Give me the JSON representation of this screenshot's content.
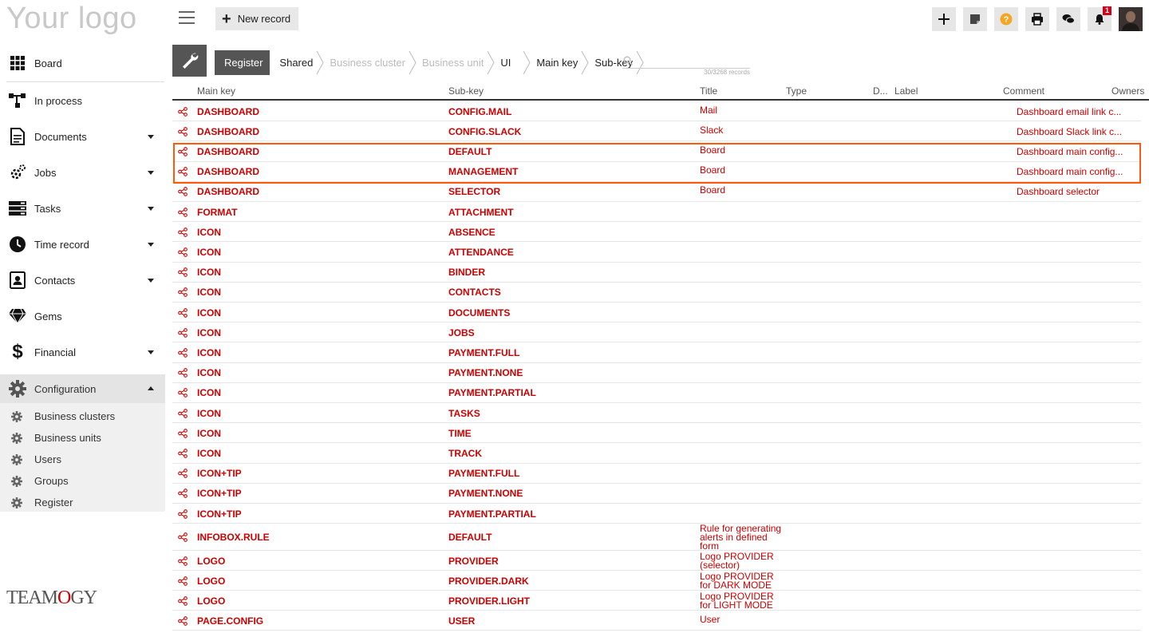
{
  "header": {
    "logo": "Your logo",
    "new_record": "New record",
    "notification_count": "1"
  },
  "sidebar": {
    "items": [
      {
        "label": "Board",
        "icon": "grid-icon"
      },
      {
        "label": "In process",
        "icon": "flow-icon"
      },
      {
        "label": "Documents",
        "icon": "document-icon"
      },
      {
        "label": "Jobs",
        "icon": "jobs-icon"
      },
      {
        "label": "Tasks",
        "icon": "tasks-icon"
      },
      {
        "label": "Time record",
        "icon": "clock-icon"
      },
      {
        "label": "Contacts",
        "icon": "contacts-icon"
      },
      {
        "label": "Gems",
        "icon": "diamond-icon"
      },
      {
        "label": "Financial",
        "icon": "dollar-icon"
      },
      {
        "label": "Configuration",
        "icon": "gear-icon"
      }
    ],
    "sub_items": [
      "Business clusters",
      "Business units",
      "Users",
      "Groups",
      "Register"
    ],
    "footer_logo": "TEAMOGY"
  },
  "breadcrumb": [
    "Register",
    "Shared",
    "Business cluster",
    "Business unit",
    "UI",
    "Main key",
    "Sub-key"
  ],
  "search": {
    "placeholder": "",
    "count": "30/3268 records"
  },
  "columns": [
    "Main key",
    "Sub-key",
    "Title",
    "Type",
    "D...",
    "Label",
    "Comment",
    "Owners"
  ],
  "rows": [
    {
      "key": "DASHBOARD",
      "sub": "CONFIG.MAIL",
      "title": "Mail",
      "comment": "Dashboard email link c..."
    },
    {
      "key": "DASHBOARD",
      "sub": "CONFIG.SLACK",
      "title": "Slack",
      "comment": "Dashboard Slack link c..."
    },
    {
      "key": "DASHBOARD",
      "sub": "DEFAULT",
      "title": "Board",
      "comment": "Dashboard main config..."
    },
    {
      "key": "DASHBOARD",
      "sub": "MANAGEMENT",
      "title": "Board",
      "comment": "Dashboard main config..."
    },
    {
      "key": "DASHBOARD",
      "sub": "SELECTOR",
      "title": "Board",
      "comment": "Dashboard selector"
    },
    {
      "key": "FORMAT",
      "sub": "ATTACHMENT",
      "title": "",
      "comment": ""
    },
    {
      "key": "ICON",
      "sub": "ABSENCE",
      "title": "",
      "comment": ""
    },
    {
      "key": "ICON",
      "sub": "ATTENDANCE",
      "title": "",
      "comment": ""
    },
    {
      "key": "ICON",
      "sub": "BINDER",
      "title": "",
      "comment": ""
    },
    {
      "key": "ICON",
      "sub": "CONTACTS",
      "title": "",
      "comment": ""
    },
    {
      "key": "ICON",
      "sub": "DOCUMENTS",
      "title": "",
      "comment": ""
    },
    {
      "key": "ICON",
      "sub": "JOBS",
      "title": "",
      "comment": ""
    },
    {
      "key": "ICON",
      "sub": "PAYMENT.FULL",
      "title": "",
      "comment": ""
    },
    {
      "key": "ICON",
      "sub": "PAYMENT.NONE",
      "title": "",
      "comment": ""
    },
    {
      "key": "ICON",
      "sub": "PAYMENT.PARTIAL",
      "title": "",
      "comment": ""
    },
    {
      "key": "ICON",
      "sub": "TASKS",
      "title": "",
      "comment": ""
    },
    {
      "key": "ICON",
      "sub": "TIME",
      "title": "",
      "comment": ""
    },
    {
      "key": "ICON",
      "sub": "TRACK",
      "title": "",
      "comment": ""
    },
    {
      "key": "ICON+TIP",
      "sub": "PAYMENT.FULL",
      "title": "",
      "comment": ""
    },
    {
      "key": "ICON+TIP",
      "sub": "PAYMENT.NONE",
      "title": "",
      "comment": ""
    },
    {
      "key": "ICON+TIP",
      "sub": "PAYMENT.PARTIAL",
      "title": "",
      "comment": ""
    },
    {
      "key": "INFOBOX.RULE",
      "sub": "DEFAULT",
      "title": "Rule for generating alerts in defined form",
      "comment": ""
    },
    {
      "key": "LOGO",
      "sub": "PROVIDER",
      "title": "Logo PROVIDER (selector)",
      "comment": ""
    },
    {
      "key": "LOGO",
      "sub": "PROVIDER.DARK",
      "title": "Logo PROVIDER for DARK MODE",
      "comment": ""
    },
    {
      "key": "LOGO",
      "sub": "PROVIDER.LIGHT",
      "title": "Logo PROVIDER for LIGHT MODE",
      "comment": ""
    },
    {
      "key": "PAGE.CONFIG",
      "sub": "USER",
      "title": "User",
      "comment": ""
    }
  ],
  "colors": {
    "accent": "#cc0000",
    "highlight": "#ff5a0a",
    "help": "#f5a623"
  }
}
